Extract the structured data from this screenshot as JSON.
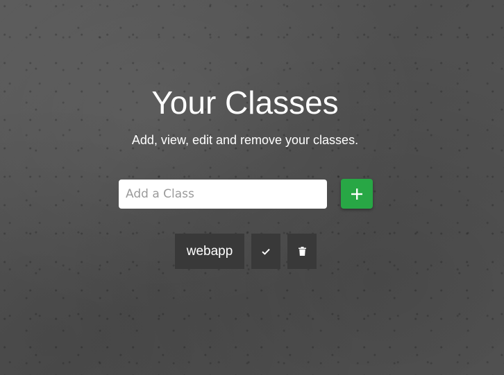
{
  "page": {
    "title": "Your Classes",
    "subtitle": "Add, view, edit and remove your classes."
  },
  "add_form": {
    "placeholder": "Add a Class",
    "value": "",
    "button_icon": "plus-icon",
    "button_color": "#28a745"
  },
  "classes": [
    {
      "name": "webapp",
      "actions": [
        {
          "icon": "check-icon"
        },
        {
          "icon": "trash-icon"
        }
      ]
    }
  ],
  "colors": {
    "background": "#525252",
    "item_background": "#393939",
    "text": "#ffffff"
  }
}
